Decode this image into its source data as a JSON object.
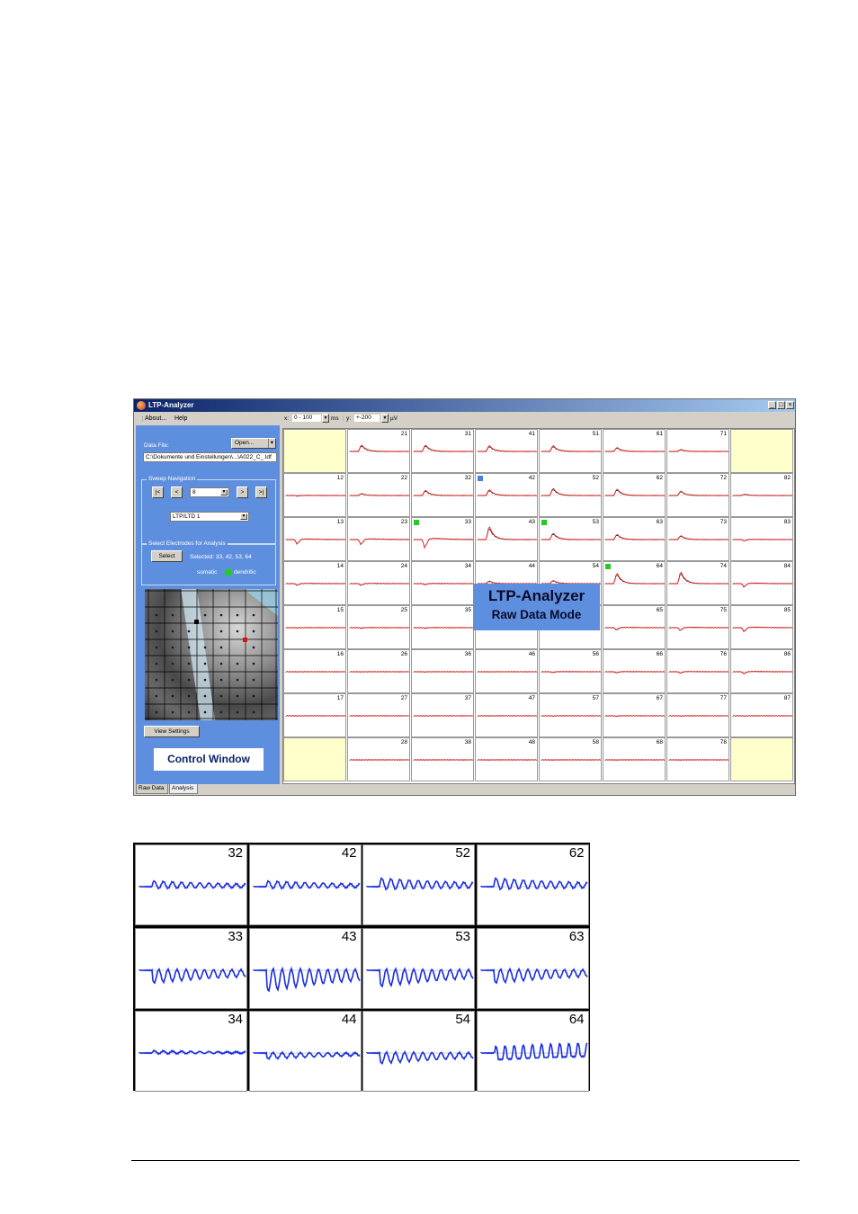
{
  "window": {
    "title": "LTP-Analyzer",
    "buttons": [
      "_",
      "□",
      "×"
    ]
  },
  "menu": {
    "about": "About...",
    "help": "Help"
  },
  "control": {
    "data_file_label": "Data File:",
    "open_button": "Open...",
    "data_file_path": "C:\\Dokumente und Einstellungen\\...\\A022_C_.ldf",
    "sweep_nav_title": "Sweep Navigation",
    "nav_first": "|<",
    "nav_prev": "<",
    "sweep_value": "8",
    "nav_next": ">",
    "nav_last": ">|",
    "mode_value": "LTP/LTD 1",
    "select_group_title": "Select Electrodes for Analysis",
    "select_button": "Select",
    "selected_text": "Selected: 33, 42, 53, 64",
    "legend_somatic": "somatic",
    "legend_dendritic": "dendritic",
    "view_settings_button": "View Settings",
    "callout": "Control Window"
  },
  "toolbar": {
    "x_label": "x:",
    "x_value": "0 - 100",
    "x_unit": "ms",
    "y_label": "y:",
    "y_value": "+-200",
    "y_unit": "µV"
  },
  "mode_callout": {
    "line1": "LTP-Analyzer",
    "line2": "Raw Data Mode"
  },
  "tabs": {
    "raw": "Raw Data",
    "analysis": "Analysis"
  },
  "colors": {
    "trace_red": "#e8201a",
    "trace_black": "#101010",
    "zoom_trace": "#1a2ee0",
    "panel_blue": "#5e8fde",
    "marker_green": "#22cc22",
    "marker_blue": "#4a7ee0"
  },
  "grid_labels": {
    "c21": "21",
    "c31": "31",
    "c41": "41",
    "c51": "51",
    "c61": "61",
    "c71": "71",
    "c12": "12",
    "c22": "22",
    "c32": "32",
    "c42": "42",
    "c52": "52",
    "c62": "62",
    "c72": "72",
    "c82": "82",
    "c13": "13",
    "c23": "23",
    "c33": "33",
    "c43": "43",
    "c53": "53",
    "c63": "63",
    "c73": "73",
    "c83": "83",
    "c14": "14",
    "c24": "24",
    "c34": "34",
    "c44": "44",
    "c54": "54",
    "c64": "64",
    "c74": "74",
    "c84": "84",
    "c15": "15",
    "c25": "25",
    "c35": "35",
    "c65": "65",
    "c75": "75",
    "c85": "85",
    "c16": "16",
    "c26": "26",
    "c36": "36",
    "c46": "46",
    "c56": "56",
    "c66": "66",
    "c76": "76",
    "c86": "86",
    "c17": "17",
    "c27": "27",
    "c37": "37",
    "c47": "47",
    "c57": "57",
    "c67": "67",
    "c77": "77",
    "c87": "87",
    "c28": "28",
    "c38": "38",
    "c48": "48",
    "c58": "58",
    "c68": "68",
    "c78": "78"
  },
  "zoom_labels": {
    "z32": "32",
    "z42": "42",
    "z52": "52",
    "z62": "62",
    "z33": "33",
    "z43": "43",
    "z53": "53",
    "z63": "63",
    "z34": "34",
    "z44": "44",
    "z54": "54",
    "z64": "64"
  }
}
